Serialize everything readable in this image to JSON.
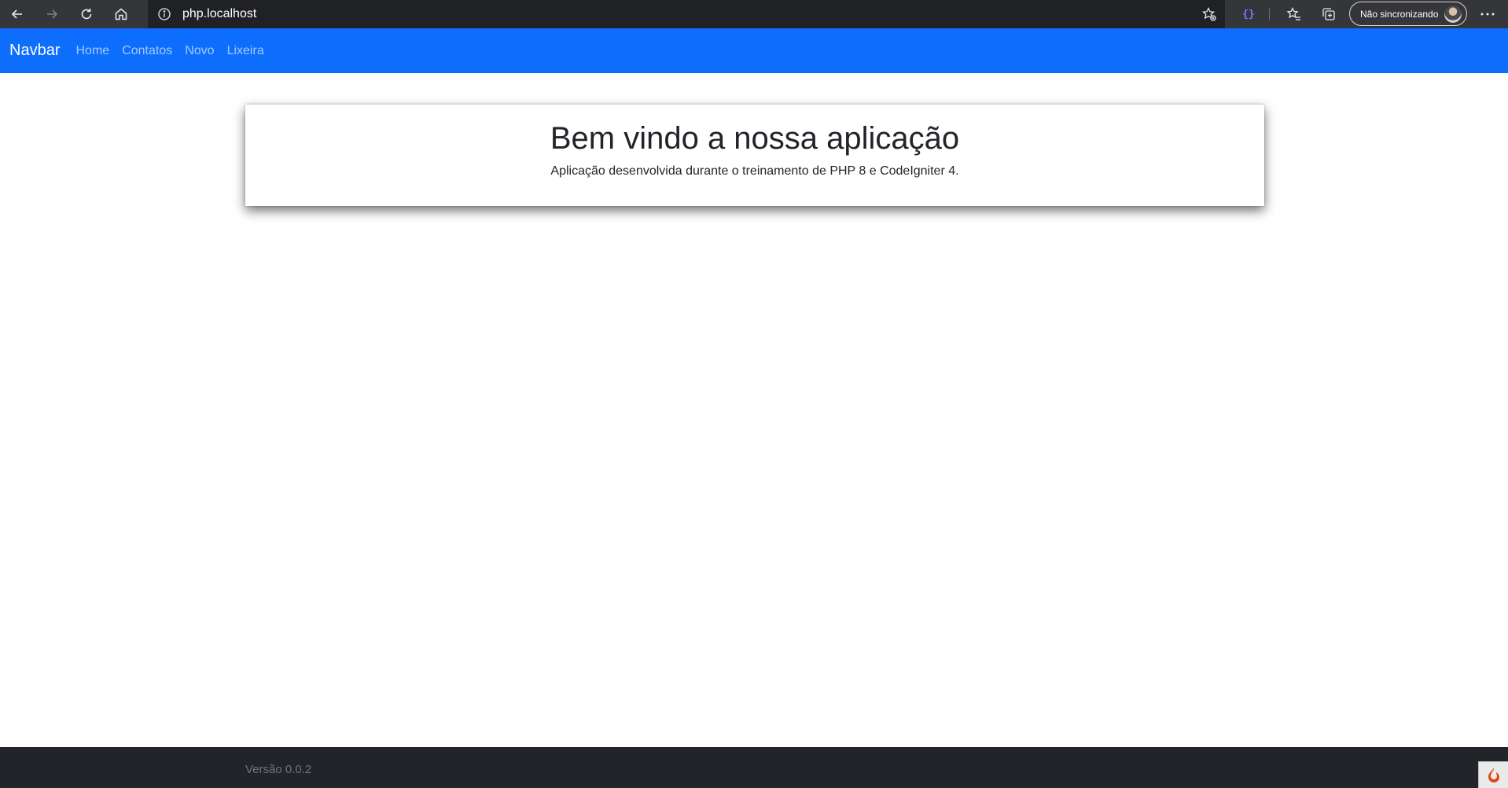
{
  "browser": {
    "url": "php.localhost",
    "sync_label": "Não sincronizando",
    "icons": [
      "back-icon",
      "forward-icon",
      "refresh-icon",
      "home-icon",
      "info-icon",
      "star-add-icon",
      "extension-icon",
      "favorites-icon",
      "collections-icon",
      "avatar",
      "more-icon"
    ]
  },
  "navbar": {
    "brand": "Navbar",
    "links": [
      "Home",
      "Contatos",
      "Novo",
      "Lixeira"
    ]
  },
  "hero": {
    "title": "Bem vindo a nossa aplicação",
    "subtitle": "Aplicação desenvolvida durante o treinamento de PHP 8 e CodeIgniter 4."
  },
  "footer": {
    "version": "Versão 0.0.2"
  },
  "colors": {
    "navbar_bg": "#0d6efd",
    "footer_bg": "#212529",
    "chrome_bg": "#35363a"
  }
}
